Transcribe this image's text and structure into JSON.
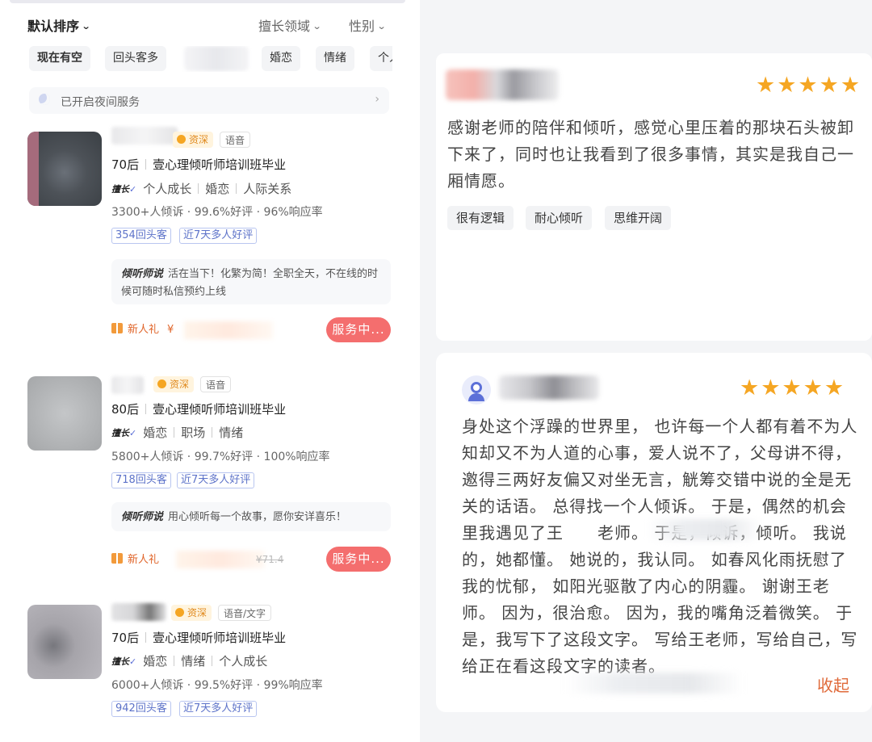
{
  "listing": {
    "sort": {
      "main": "默认排序",
      "field_filter": "擅长领域",
      "gender_filter": "性别"
    },
    "chips": [
      "现在有空",
      "回头客多",
      "婚恋",
      "情绪",
      "个人"
    ],
    "night_service": "已开启夜间服务",
    "cards": [
      {
        "senior_badge": "资深",
        "mode": "语音",
        "age": "70后",
        "qualification": "壹心理倾听师培训班毕业",
        "specialty_label": "擅长",
        "specialties": [
          "个人成长",
          "婚恋",
          "人际关系"
        ],
        "stats": "3300+人倾诉 · 99.6%好评 · 96%响应率",
        "pills": [
          "354回头客",
          "近7天多人好评"
        ],
        "quote_label": "倾听师说",
        "quote": "活在当下！化繁为简！全职全天，不在线的时候可随时私信预约上线",
        "gift": "新人礼",
        "price_prefix": "¥",
        "price_strike": "",
        "status": "服务中..."
      },
      {
        "senior_badge": "资深",
        "mode": "语音",
        "age": "80后",
        "qualification": "壹心理倾听师培训班毕业",
        "specialty_label": "擅长",
        "specialties": [
          "婚恋",
          "职场",
          "情绪"
        ],
        "stats": "5800+人倾诉 · 99.7%好评 · 100%响应率",
        "pills": [
          "718回头客",
          "近7天多人好评"
        ],
        "quote_label": "倾听师说",
        "quote": "用心倾听每一个故事，愿你安详喜乐！",
        "gift": "新人礼",
        "price_prefix": "",
        "price_strike": "¥71.4",
        "status": "服务中..."
      },
      {
        "senior_badge": "资深",
        "mode": "语音/文字",
        "age": "70后",
        "qualification": "壹心理倾听师培训班毕业",
        "specialty_label": "擅长",
        "specialties": [
          "婚恋",
          "情绪",
          "个人成长"
        ],
        "stats": "6000+人倾诉 · 99.5%好评 · 99%响应率",
        "pills": [
          "942回头客",
          "近7天多人好评"
        ]
      }
    ]
  },
  "reviews": [
    {
      "stars": "★★★★★",
      "text": "感谢老师的陪伴和倾听，感觉心里压着的那块石头被卸下来了，同时也让我看到了很多事情，其实是我自己一厢情愿。",
      "tags": [
        "很有逻辑",
        "耐心倾听",
        "思维开阔"
      ]
    },
    {
      "stars": "★★★★★",
      "text": "身处这个浮躁的世界里， 也许每一个人都有着不为人知却又不为人道的心事，爱人说不了，父母讲不得，邀得三两好友偏又对坐无言，觥筹交错中说的全是无关的话语。 总得找一个人倾诉。 于是，偶然的机会里我遇见了王　　老师。 于是，倾诉，倾听。 我说的，她都懂。 她说的，我认同。 如春风化雨抚慰了我的忧郁， 如阳光驱散了内心的阴霾。 谢谢王老师。 因为，很治愈。 因为，我的嘴角泛着微笑。 于是，我写下了这段文字。 写给王老师，写给自己，写给正在看这段文字的读者。",
      "collapse": "收起"
    }
  ],
  "colors": {
    "accent_orange": "#f5a623",
    "serving_red": "#f46e6e",
    "pill_blue": "#5d73c9",
    "collapse_orange": "#e06a3a"
  },
  "icons": [
    "chevron-down-icon",
    "moon-icon",
    "chevron-right-icon",
    "senior-badge-icon",
    "gift-icon",
    "star-icon",
    "user-avatar-icon"
  ]
}
